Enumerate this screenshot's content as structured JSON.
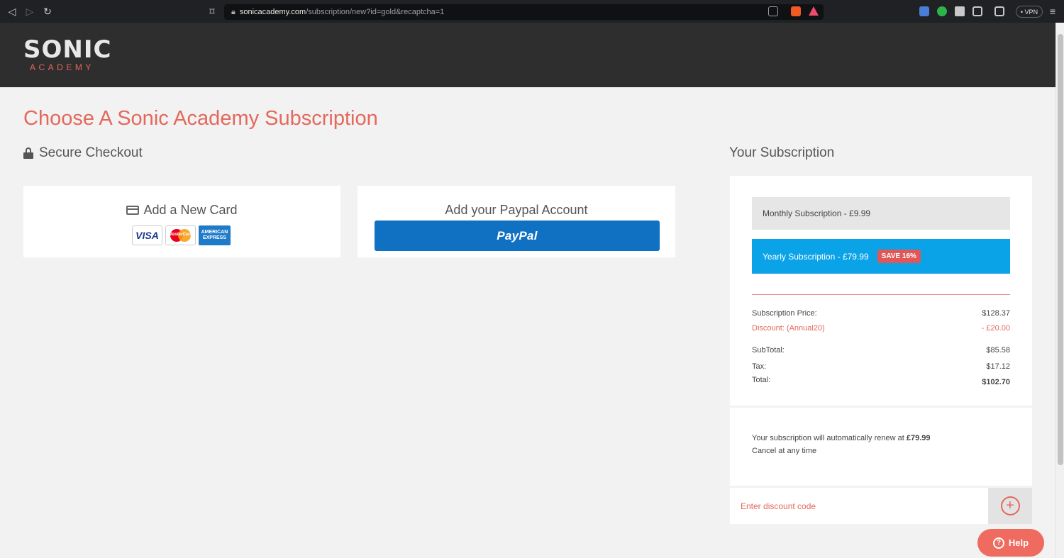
{
  "browser": {
    "url_host": "sonicacademy.com",
    "url_path": "/subscription/new?id=gold&recaptcha=1",
    "vpn_label": "• VPN"
  },
  "header": {
    "logo_main": "SONIC",
    "logo_sub": "ACADEMY"
  },
  "page": {
    "title": "Choose A Sonic Academy Subscription",
    "secure_checkout": "Secure Checkout",
    "your_subscription": "Your Subscription"
  },
  "payment": {
    "card_label": "Add a New Card",
    "card_brands": [
      "VISA",
      "MasterCard",
      "AMERICAN EXPRESS"
    ],
    "paypal_label": "Add your Paypal Account",
    "paypal_button": "PayPal"
  },
  "subscription": {
    "monthly_label": "Monthly Subscription - £9.99",
    "yearly_label": "Yearly Subscription - £79.99",
    "save_badge": "SAVE 16%",
    "selected": "yearly",
    "lines": [
      {
        "label": "Subscription Price:",
        "value": "$128.37"
      },
      {
        "label": "Discount: (Annual20)",
        "value": "- £20.00"
      },
      {
        "label": "SubTotal:",
        "value": "$85.58"
      },
      {
        "label": "Tax:",
        "value": "$17.12"
      },
      {
        "label": "Total:",
        "value": "$102.70"
      }
    ],
    "renew_text": "Your subscription will automatically renew at",
    "renew_price": "£79.99",
    "cancel_text": "Cancel at any time"
  },
  "discount": {
    "placeholder": "Enter discount code"
  },
  "help": {
    "label": "Help"
  },
  "colors": {
    "accent": "#e4685c",
    "selected_plan": "#0aa3e8",
    "paypal": "#1070c2",
    "header_bg": "#2e2e2e"
  }
}
